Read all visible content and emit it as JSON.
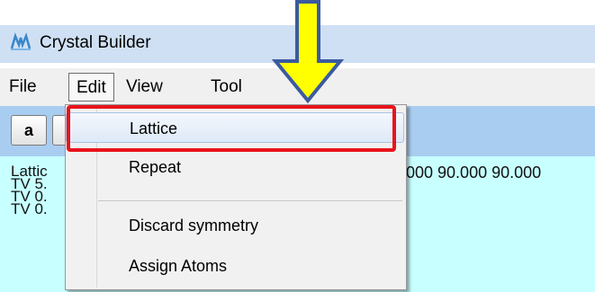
{
  "window": {
    "title": "Crystal Builder",
    "icon": "crystal-app-icon"
  },
  "menubar": {
    "items": [
      "File",
      "Edit",
      "View",
      "Tool"
    ],
    "active": "Edit"
  },
  "toolbar": {
    "button_a": "a"
  },
  "content": {
    "line1_left": "Lattic",
    "line1_right": ".000 90.000 90.000",
    "line2": "TV 5.",
    "line3": "TV 0.",
    "line4": "TV 0."
  },
  "dropdown": {
    "items": [
      "Lattice",
      "Repeat",
      "Discard symmetry",
      "Assign Atoms"
    ],
    "hovered": "Lattice"
  },
  "annotations": {
    "arrow_icon": "down-arrow-icon",
    "highlight_color": "#e8141c",
    "arrow_color": "#ffff00"
  },
  "colors": {
    "toolbar_bg": "#a9cdf0",
    "content_bg": "#c8ffff",
    "titlebar_bg": "#cfe0f4"
  }
}
